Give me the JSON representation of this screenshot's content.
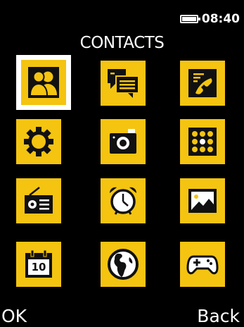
{
  "status": {
    "time": "08:40",
    "battery_icon": "battery-full-icon"
  },
  "title": "CONTACTS",
  "menu": {
    "accent_color": "#f4c411",
    "selected_index": 0,
    "items": [
      {
        "icon": "contacts-icon"
      },
      {
        "icon": "messages-icon"
      },
      {
        "icon": "call-log-icon"
      },
      {
        "icon": "settings-gear-icon"
      },
      {
        "icon": "camera-icon"
      },
      {
        "icon": "apps-grid-icon"
      },
      {
        "icon": "radio-icon"
      },
      {
        "icon": "alarm-clock-icon"
      },
      {
        "icon": "gallery-icon"
      },
      {
        "icon": "calendar-icon",
        "text": "10"
      },
      {
        "icon": "globe-icon"
      },
      {
        "icon": "games-icon"
      }
    ]
  },
  "softkeys": {
    "left": "OK",
    "right": "Back"
  }
}
